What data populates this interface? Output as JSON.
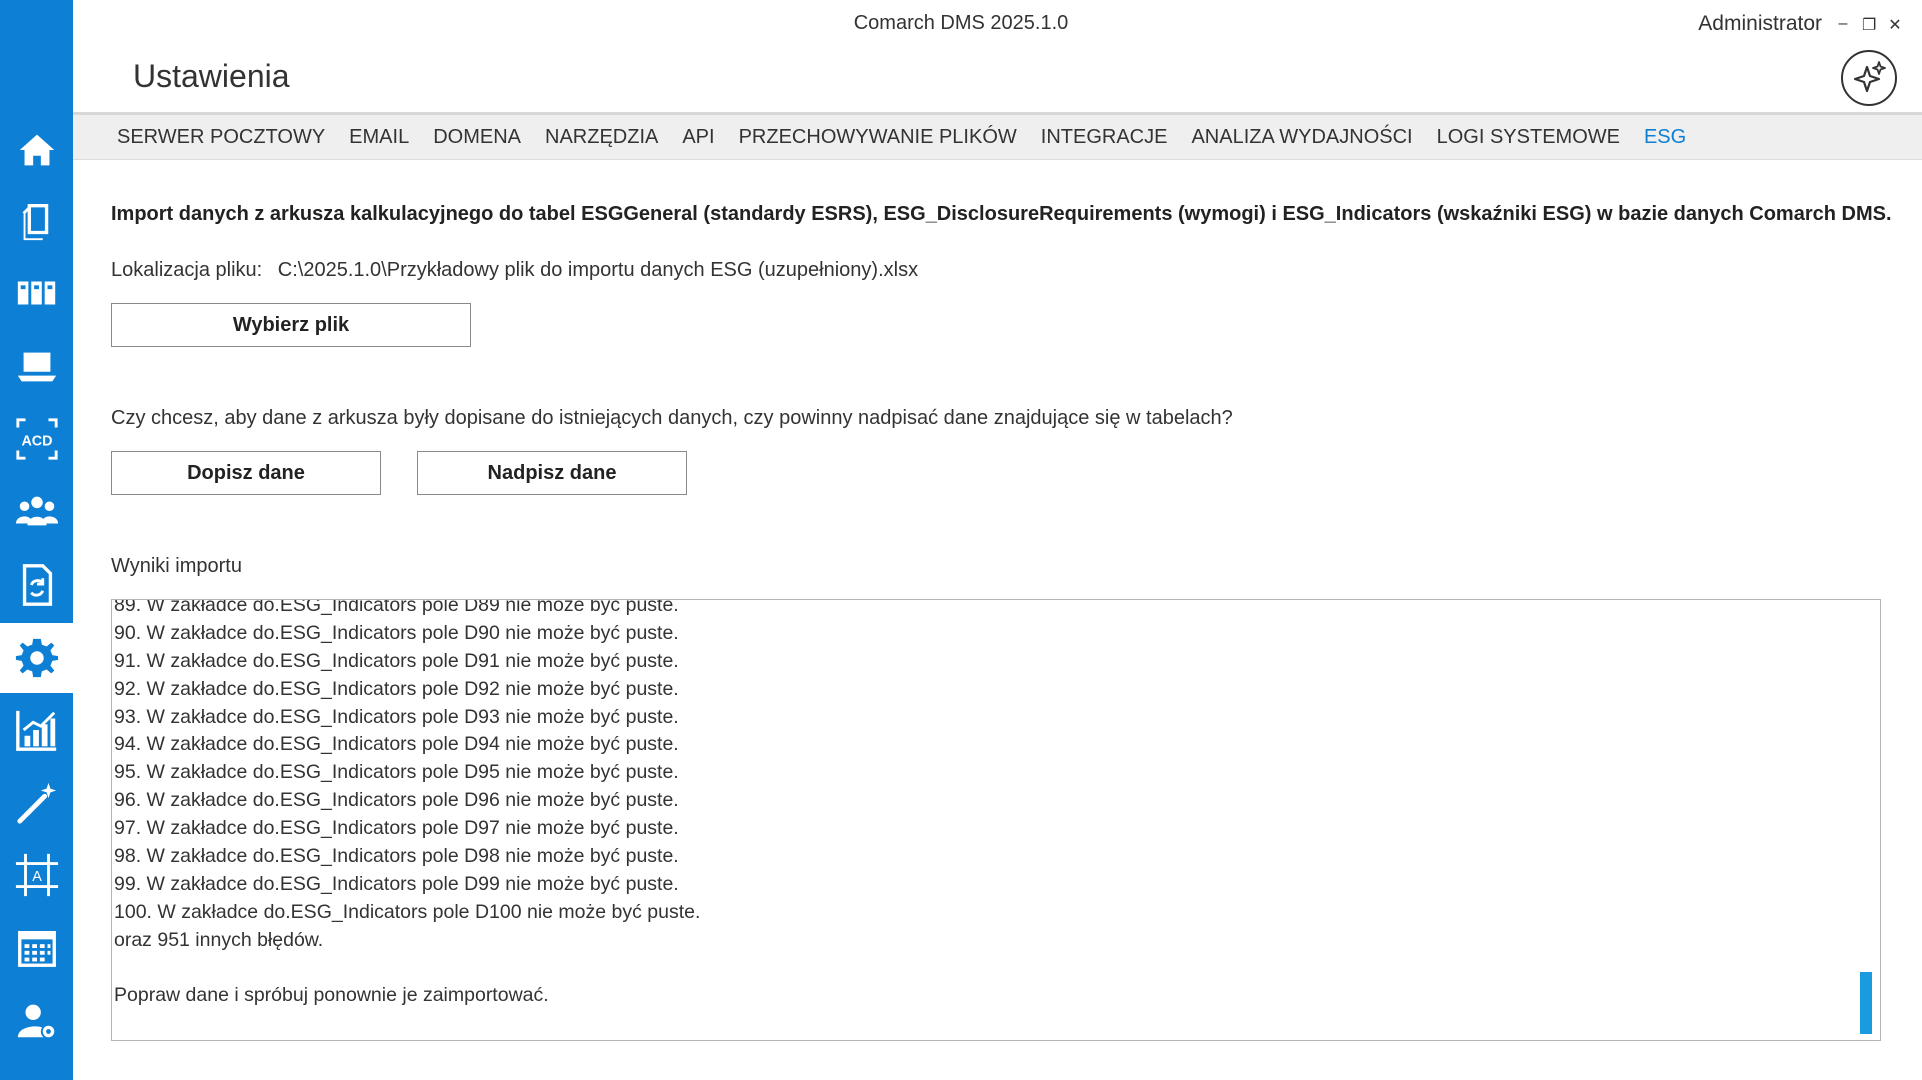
{
  "app_title": "Comarch DMS 2025.1.0",
  "user": "Administrator",
  "window_controls": [
    "–",
    "❐",
    "✕"
  ],
  "page_title": "Ustawienia",
  "sidebar": {
    "items": [
      {
        "icon": "home-icon"
      },
      {
        "icon": "documents-icon"
      },
      {
        "icon": "repository-icon"
      },
      {
        "icon": "laptop-icon"
      },
      {
        "icon": "acd-icon",
        "text": "ACD"
      },
      {
        "icon": "users-icon"
      },
      {
        "icon": "workflow-document-icon"
      },
      {
        "icon": "gear-icon",
        "active": true
      },
      {
        "icon": "chart-icon"
      },
      {
        "icon": "magic-wand-icon"
      },
      {
        "icon": "form-designer-icon",
        "text": "A"
      },
      {
        "icon": "calendar-icon"
      },
      {
        "icon": "user-settings-icon"
      }
    ]
  },
  "tabs": [
    {
      "label": "SERWER POCZTOWY"
    },
    {
      "label": "EMAIL"
    },
    {
      "label": "DOMENA"
    },
    {
      "label": "NARZĘDZIA"
    },
    {
      "label": "API"
    },
    {
      "label": "PRZECHOWYWANIE PLIKÓW"
    },
    {
      "label": "INTEGRACJE"
    },
    {
      "label": "ANALIZA WYDAJNOŚCI"
    },
    {
      "label": "LOGI SYSTEMOWE"
    },
    {
      "label": "ESG",
      "active": true
    }
  ],
  "content": {
    "heading": "Import danych z arkusza kalkulacyjnego do tabel ESGGeneral (standardy ESRS), ESG_DisclosureRequirements (wymogi) i ESG_Indicators (wskaźniki ESG) w bazie danych Comarch DMS.",
    "file_location_label": "Lokalizacja pliku:",
    "file_location_value": "C:\\2025.1.0\\Przykładowy plik do importu danych ESG (uzupełniony).xlsx",
    "choose_file_button": "Wybierz plik",
    "question": "Czy chcesz, aby dane z arkusza były dopisane do istniejących danych, czy powinny nadpisać dane znajdujące się w tabelach?",
    "append_button": "Dopisz dane",
    "overwrite_button": "Nadpisz dane",
    "results_label": "Wyniki importu",
    "results_lines": [
      "89. W zakładce do.ESG_Indicators pole D89 nie może być puste.",
      "90. W zakładce do.ESG_Indicators pole D90 nie może być puste.",
      "91. W zakładce do.ESG_Indicators pole D91 nie może być puste.",
      "92. W zakładce do.ESG_Indicators pole D92 nie może być puste.",
      "93. W zakładce do.ESG_Indicators pole D93 nie może być puste.",
      "94. W zakładce do.ESG_Indicators pole D94 nie może być puste.",
      "95. W zakładce do.ESG_Indicators pole D95 nie może być puste.",
      "96. W zakładce do.ESG_Indicators pole D96 nie może być puste.",
      "97. W zakładce do.ESG_Indicators pole D97 nie może być puste.",
      "98. W zakładce do.ESG_Indicators pole D98 nie może być puste.",
      "99. W zakładce do.ESG_Indicators pole D99 nie może być puste.",
      "100. W zakładce do.ESG_Indicators pole D100 nie może być puste.",
      "oraz 951 innych błędów.",
      "",
      "Popraw dane i spróbuj ponownie je zaimportować."
    ]
  },
  "colors": {
    "accent": "#0d7fd4",
    "scrollbar": "#1a9be0"
  }
}
